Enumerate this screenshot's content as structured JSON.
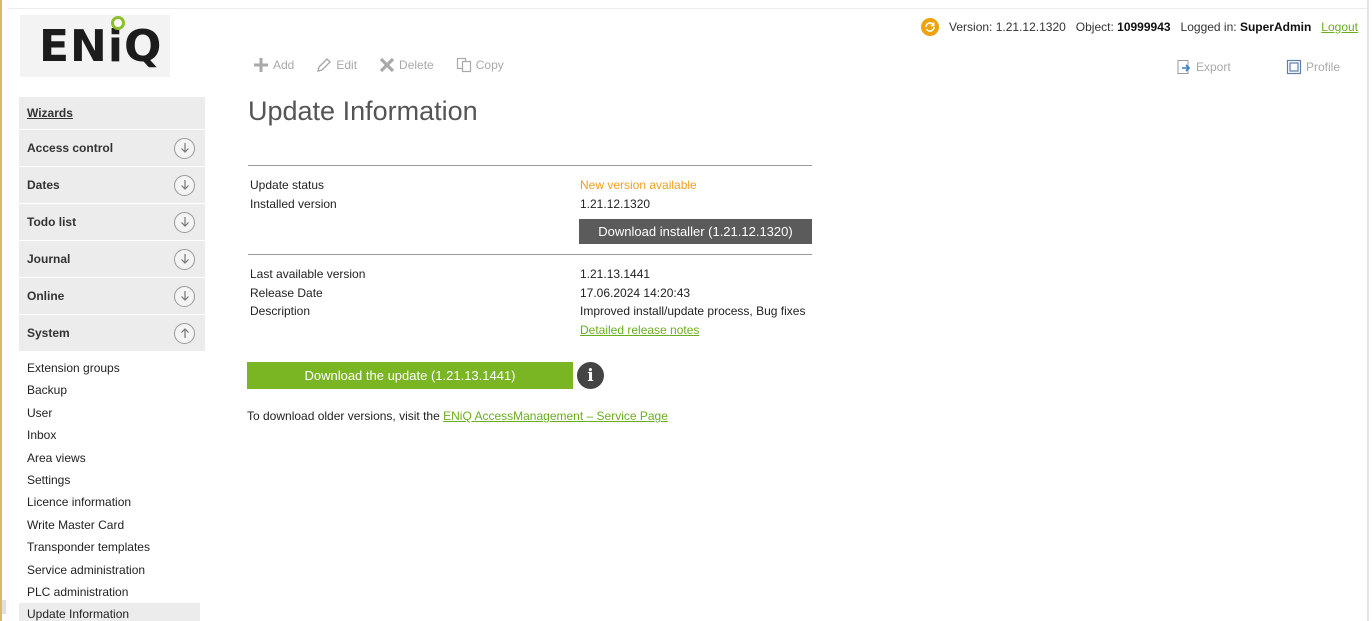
{
  "logo": {
    "text": "ENiQ"
  },
  "toolbar": {
    "add": "Add",
    "edit": "Edit",
    "delete": "Delete",
    "copy": "Copy",
    "export": "Export",
    "profile": "Profile"
  },
  "status": {
    "version_label": "Version: 1.21.12.1320",
    "object_label": "Object:",
    "object_value": "10999943",
    "logged_label": "Logged in:",
    "logged_user": "SuperAdmin",
    "logout": "Logout"
  },
  "sidebar": {
    "wizards": "Wizards",
    "groups": [
      {
        "label": "Access control",
        "state": "collapsed"
      },
      {
        "label": "Dates",
        "state": "collapsed"
      },
      {
        "label": "Todo list",
        "state": "collapsed"
      },
      {
        "label": "Journal",
        "state": "collapsed"
      },
      {
        "label": "Online",
        "state": "collapsed"
      },
      {
        "label": "System",
        "state": "expanded"
      }
    ],
    "system_items": [
      "Extension groups",
      "Backup",
      "User",
      "Inbox",
      "Area views",
      "Settings",
      "Licence information",
      "Write Master Card",
      "Transponder templates",
      "Service administration",
      "PLC administration",
      "Update Information"
    ],
    "active_item": "Update Information"
  },
  "main": {
    "title": "Update Information",
    "update_status_label": "Update status",
    "update_status_value": "New version available",
    "installed_version_label": "Installed version",
    "installed_version_value": "1.21.12.1320",
    "download_installer": "Download installer (1.21.12.1320)",
    "last_version_label": "Last available version",
    "last_version_value": "1.21.13.1441",
    "release_date_label": "Release Date",
    "release_date_value": "17.06.2024 14:20:43",
    "description_label": "Description",
    "description_value": "Improved install/update process, Bug fixes",
    "release_notes_link": "Detailed release notes",
    "download_update": "Download the update (1.21.13.1441)",
    "info_glyph": "i",
    "older_text": "To download older versions, visit the ",
    "older_link": "ENiQ AccessManagement – Service Page"
  },
  "colors": {
    "accent_green": "#7ab524",
    "status_orange": "#f0a020",
    "dark_button": "#5b5b5b"
  }
}
